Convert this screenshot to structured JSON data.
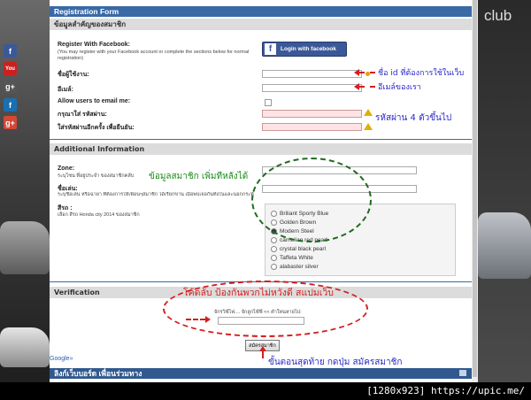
{
  "brand_right": "club",
  "social_icons": [
    {
      "name": "facebook-icon",
      "glyph": "f",
      "color": "#3b5998"
    },
    {
      "name": "youtube-icon",
      "glyph": "You",
      "color": "#cc2020"
    },
    {
      "name": "googleplus-icon",
      "glyph": "g+",
      "color": "#555555"
    },
    {
      "name": "flickr-icon",
      "glyph": "f",
      "color": "#1a6fb0"
    },
    {
      "name": "googleplus-red-icon",
      "glyph": "g+",
      "color": "#d34836"
    }
  ],
  "form": {
    "title": "Registration Form",
    "section_required": "ข้อมูลสำคัญของสมาชิก",
    "fb_register_title": "Register With Facebook:",
    "fb_register_desc": "(You may register with your Facebook account or complete the sections below for normal registration)",
    "fb_button": "Login with facebook",
    "username_label": "ชื่อผู้ใช้งาน:",
    "email_label": "อีเมล์:",
    "allow_email_label": "Allow users to email me:",
    "password_label": "กรุณาใส่ รหัสผ่าน:",
    "password_confirm_label": "ใส่รหัสผ่านอีกครั้ง เพื่อยืนยัน:",
    "additional_title": "Additional Information",
    "zone_label": "Zone:",
    "zone_desc": "ระบุโซน ที่อยู่ประจำ ของสมาชิกคลับ",
    "nickname_label": "ชื่อเล่น:",
    "nickname_desc": "ระบุชื่อเล่น หรือฉายา ที่ต้องการให้เพื่อนๆสมาชิก ได้เรียกขาน เมื่อพบเจอกันทั้งในและนอกกระทู้",
    "color_label": "สีรถ :",
    "color_desc": "เลือก สีรถ Honda city 2014 ของสมาชิก",
    "color_options": [
      "Briliant Sporty Blue",
      "Golden Brown",
      "Modern Steel",
      "carnelian red pearl",
      "crystal black pearl",
      "Taffeta White",
      "alabaster silver"
    ],
    "color_selected": "Modern Steel",
    "verification_title": "Verification",
    "verification_question": "จักรวิฟ์ไฟ.... จักลูกไฟ์ฟี << คำใหนหายไป:",
    "submit_button": "สมัครสมาชิก",
    "google_link": "Google»",
    "forum_bar": "ลิงก์เว็บบอร์ด เพื่อนร่วมทาง"
  },
  "annotations": {
    "username_hint": "ชื่อ id ที่ต้องการใช้ในเว็บ",
    "email_hint": "อีเมล์ของเรา",
    "password_hint": "รหัสผ่าน 4 ตัวขึ้นไป",
    "additional_hint": "ข้อมูลสมาชิก เพิ่มทีหลังได้",
    "verify_hint": "โค้ดลับ ป้องกันพวกไม่หวังดี สแปมเว็บ",
    "submit_hint": "ขั้นตอนสุดท้าย กดปุ่ม สมัครสมาชิก"
  },
  "footer_text": "[1280x923] https://upic.me/"
}
